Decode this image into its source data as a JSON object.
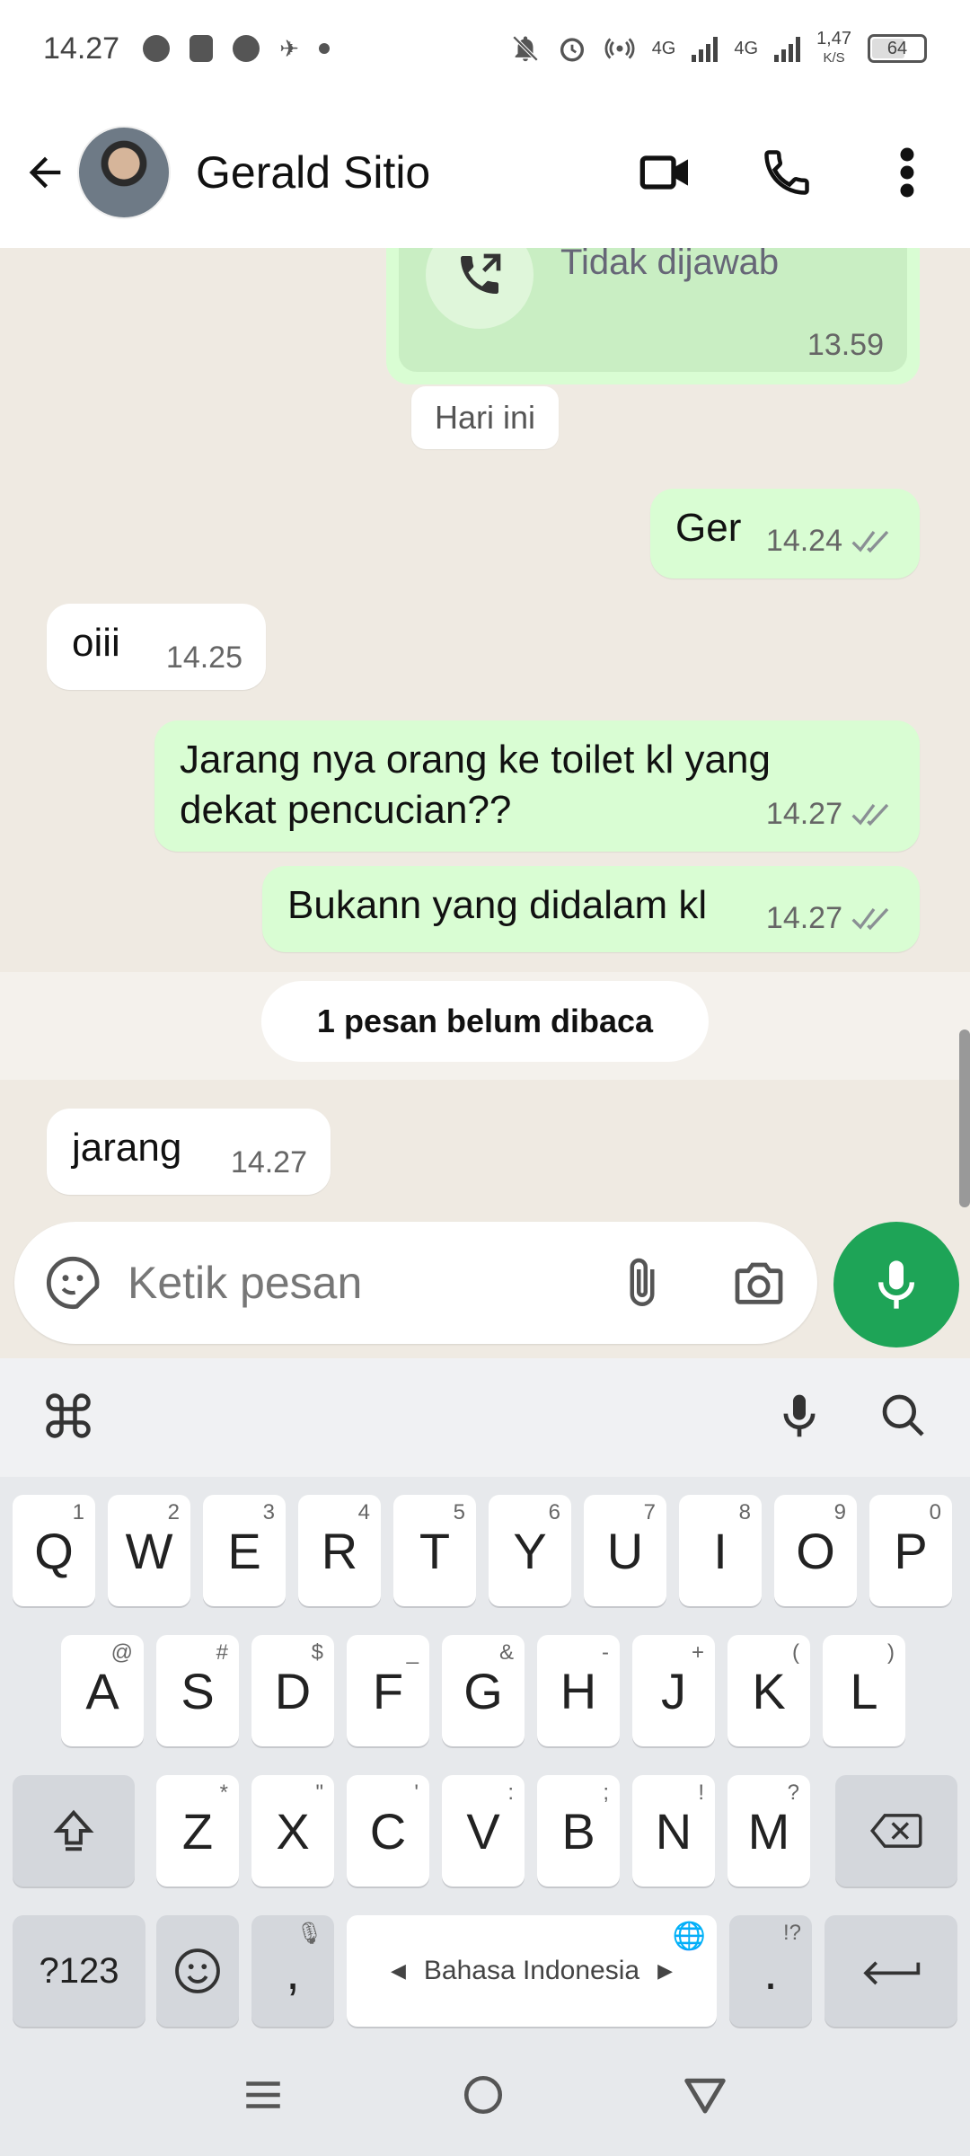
{
  "status_bar": {
    "time": "14.27",
    "network_1": "4G",
    "network_2": "4G",
    "speed_value": "1,47",
    "speed_unit": "K/S",
    "battery": "64"
  },
  "header": {
    "contact_name": "Gerald Sitio",
    "icons": [
      "back-arrow-icon",
      "avatar",
      "video-call-icon",
      "phone-icon",
      "more-vert-icon"
    ]
  },
  "chat": {
    "call_message": {
      "status": "Tidak dijawab",
      "time": "13.59"
    },
    "day_separator": "Hari ini",
    "messages": [
      {
        "dir": "out",
        "text": "Ger",
        "time": "14.24",
        "read": true
      },
      {
        "dir": "in",
        "text": "oiii",
        "time": "14.25"
      },
      {
        "dir": "out",
        "text": "Jarang nya orang ke toilet kl yang dekat pencucian??",
        "time": "14.27",
        "read": true
      },
      {
        "dir": "out",
        "text": "Bukann yang didalam kl",
        "time": "14.27",
        "read": true
      },
      {
        "dir": "in",
        "text": "jarang",
        "time": "14.27"
      }
    ],
    "unread_banner": "1 pesan belum dibaca"
  },
  "composer": {
    "placeholder": "Ketik pesan"
  },
  "keyboard": {
    "row1": [
      [
        "Q",
        "1"
      ],
      [
        "W",
        "2"
      ],
      [
        "E",
        "3"
      ],
      [
        "R",
        "4"
      ],
      [
        "T",
        "5"
      ],
      [
        "Y",
        "6"
      ],
      [
        "U",
        "7"
      ],
      [
        "I",
        "8"
      ],
      [
        "O",
        "9"
      ],
      [
        "P",
        "0"
      ]
    ],
    "row2": [
      [
        "A",
        "@"
      ],
      [
        "S",
        "#"
      ],
      [
        "D",
        "$"
      ],
      [
        "F",
        "_"
      ],
      [
        "G",
        "&"
      ],
      [
        "H",
        "-"
      ],
      [
        "J",
        "+"
      ],
      [
        "K",
        "("
      ],
      [
        "L",
        ")"
      ]
    ],
    "row3": [
      [
        "Z",
        "*"
      ],
      [
        "X",
        "\""
      ],
      [
        "C",
        "'"
      ],
      [
        "V",
        ":"
      ],
      [
        "B",
        ";"
      ],
      [
        "N",
        "!"
      ],
      [
        "M",
        "?"
      ]
    ],
    "symbols_key": "?123",
    "comma_key": ",",
    "period_key": ".",
    "period_hint": "!?",
    "language": "Bahasa Indonesia"
  },
  "colors": {
    "outgoing_bubble": "#d9fdd3",
    "incoming_bubble": "#ffffff",
    "chat_background": "#efeae2",
    "accent_green": "#1ea457",
    "read_ticks": "#8a8f94"
  }
}
